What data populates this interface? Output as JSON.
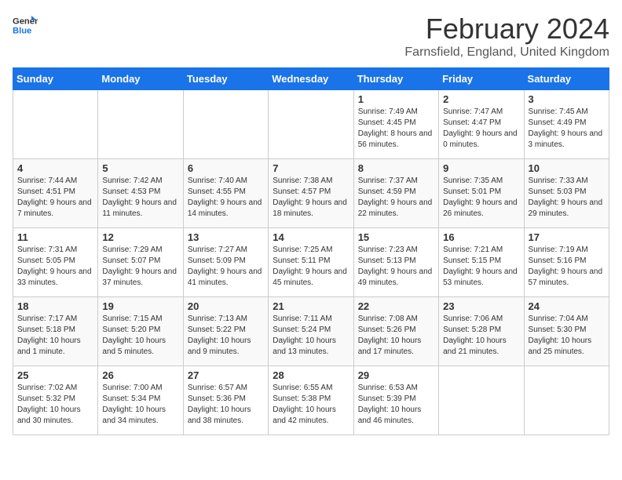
{
  "logo": {
    "line1": "General",
    "line2": "Blue"
  },
  "title": "February 2024",
  "location": "Farnsfield, England, United Kingdom",
  "headers": [
    "Sunday",
    "Monday",
    "Tuesday",
    "Wednesday",
    "Thursday",
    "Friday",
    "Saturday"
  ],
  "weeks": [
    [
      {
        "day": "",
        "sunrise": "",
        "sunset": "",
        "daylight": ""
      },
      {
        "day": "",
        "sunrise": "",
        "sunset": "",
        "daylight": ""
      },
      {
        "day": "",
        "sunrise": "",
        "sunset": "",
        "daylight": ""
      },
      {
        "day": "",
        "sunrise": "",
        "sunset": "",
        "daylight": ""
      },
      {
        "day": "1",
        "sunrise": "Sunrise: 7:49 AM",
        "sunset": "Sunset: 4:45 PM",
        "daylight": "Daylight: 8 hours and 56 minutes."
      },
      {
        "day": "2",
        "sunrise": "Sunrise: 7:47 AM",
        "sunset": "Sunset: 4:47 PM",
        "daylight": "Daylight: 9 hours and 0 minutes."
      },
      {
        "day": "3",
        "sunrise": "Sunrise: 7:45 AM",
        "sunset": "Sunset: 4:49 PM",
        "daylight": "Daylight: 9 hours and 3 minutes."
      }
    ],
    [
      {
        "day": "4",
        "sunrise": "Sunrise: 7:44 AM",
        "sunset": "Sunset: 4:51 PM",
        "daylight": "Daylight: 9 hours and 7 minutes."
      },
      {
        "day": "5",
        "sunrise": "Sunrise: 7:42 AM",
        "sunset": "Sunset: 4:53 PM",
        "daylight": "Daylight: 9 hours and 11 minutes."
      },
      {
        "day": "6",
        "sunrise": "Sunrise: 7:40 AM",
        "sunset": "Sunset: 4:55 PM",
        "daylight": "Daylight: 9 hours and 14 minutes."
      },
      {
        "day": "7",
        "sunrise": "Sunrise: 7:38 AM",
        "sunset": "Sunset: 4:57 PM",
        "daylight": "Daylight: 9 hours and 18 minutes."
      },
      {
        "day": "8",
        "sunrise": "Sunrise: 7:37 AM",
        "sunset": "Sunset: 4:59 PM",
        "daylight": "Daylight: 9 hours and 22 minutes."
      },
      {
        "day": "9",
        "sunrise": "Sunrise: 7:35 AM",
        "sunset": "Sunset: 5:01 PM",
        "daylight": "Daylight: 9 hours and 26 minutes."
      },
      {
        "day": "10",
        "sunrise": "Sunrise: 7:33 AM",
        "sunset": "Sunset: 5:03 PM",
        "daylight": "Daylight: 9 hours and 29 minutes."
      }
    ],
    [
      {
        "day": "11",
        "sunrise": "Sunrise: 7:31 AM",
        "sunset": "Sunset: 5:05 PM",
        "daylight": "Daylight: 9 hours and 33 minutes."
      },
      {
        "day": "12",
        "sunrise": "Sunrise: 7:29 AM",
        "sunset": "Sunset: 5:07 PM",
        "daylight": "Daylight: 9 hours and 37 minutes."
      },
      {
        "day": "13",
        "sunrise": "Sunrise: 7:27 AM",
        "sunset": "Sunset: 5:09 PM",
        "daylight": "Daylight: 9 hours and 41 minutes."
      },
      {
        "day": "14",
        "sunrise": "Sunrise: 7:25 AM",
        "sunset": "Sunset: 5:11 PM",
        "daylight": "Daylight: 9 hours and 45 minutes."
      },
      {
        "day": "15",
        "sunrise": "Sunrise: 7:23 AM",
        "sunset": "Sunset: 5:13 PM",
        "daylight": "Daylight: 9 hours and 49 minutes."
      },
      {
        "day": "16",
        "sunrise": "Sunrise: 7:21 AM",
        "sunset": "Sunset: 5:15 PM",
        "daylight": "Daylight: 9 hours and 53 minutes."
      },
      {
        "day": "17",
        "sunrise": "Sunrise: 7:19 AM",
        "sunset": "Sunset: 5:16 PM",
        "daylight": "Daylight: 9 hours and 57 minutes."
      }
    ],
    [
      {
        "day": "18",
        "sunrise": "Sunrise: 7:17 AM",
        "sunset": "Sunset: 5:18 PM",
        "daylight": "Daylight: 10 hours and 1 minute."
      },
      {
        "day": "19",
        "sunrise": "Sunrise: 7:15 AM",
        "sunset": "Sunset: 5:20 PM",
        "daylight": "Daylight: 10 hours and 5 minutes."
      },
      {
        "day": "20",
        "sunrise": "Sunrise: 7:13 AM",
        "sunset": "Sunset: 5:22 PM",
        "daylight": "Daylight: 10 hours and 9 minutes."
      },
      {
        "day": "21",
        "sunrise": "Sunrise: 7:11 AM",
        "sunset": "Sunset: 5:24 PM",
        "daylight": "Daylight: 10 hours and 13 minutes."
      },
      {
        "day": "22",
        "sunrise": "Sunrise: 7:08 AM",
        "sunset": "Sunset: 5:26 PM",
        "daylight": "Daylight: 10 hours and 17 minutes."
      },
      {
        "day": "23",
        "sunrise": "Sunrise: 7:06 AM",
        "sunset": "Sunset: 5:28 PM",
        "daylight": "Daylight: 10 hours and 21 minutes."
      },
      {
        "day": "24",
        "sunrise": "Sunrise: 7:04 AM",
        "sunset": "Sunset: 5:30 PM",
        "daylight": "Daylight: 10 hours and 25 minutes."
      }
    ],
    [
      {
        "day": "25",
        "sunrise": "Sunrise: 7:02 AM",
        "sunset": "Sunset: 5:32 PM",
        "daylight": "Daylight: 10 hours and 30 minutes."
      },
      {
        "day": "26",
        "sunrise": "Sunrise: 7:00 AM",
        "sunset": "Sunset: 5:34 PM",
        "daylight": "Daylight: 10 hours and 34 minutes."
      },
      {
        "day": "27",
        "sunrise": "Sunrise: 6:57 AM",
        "sunset": "Sunset: 5:36 PM",
        "daylight": "Daylight: 10 hours and 38 minutes."
      },
      {
        "day": "28",
        "sunrise": "Sunrise: 6:55 AM",
        "sunset": "Sunset: 5:38 PM",
        "daylight": "Daylight: 10 hours and 42 minutes."
      },
      {
        "day": "29",
        "sunrise": "Sunrise: 6:53 AM",
        "sunset": "Sunset: 5:39 PM",
        "daylight": "Daylight: 10 hours and 46 minutes."
      },
      {
        "day": "",
        "sunrise": "",
        "sunset": "",
        "daylight": ""
      },
      {
        "day": "",
        "sunrise": "",
        "sunset": "",
        "daylight": ""
      }
    ]
  ]
}
